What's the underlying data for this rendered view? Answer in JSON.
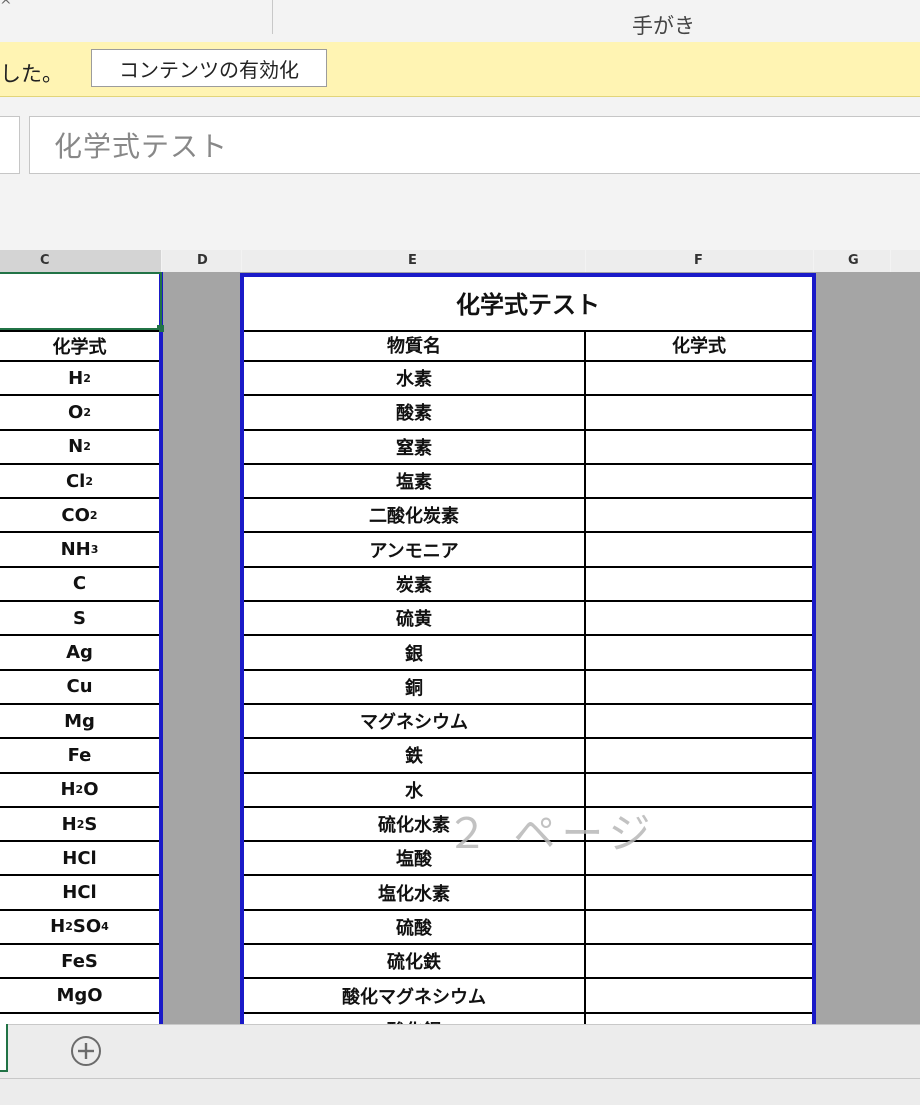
{
  "ribbon": {
    "group_label": "手がき",
    "caret": "^"
  },
  "message_bar": {
    "text": "した。",
    "enable_button": "コンテンツの有効化"
  },
  "formula_bar": {
    "value": "化学式テスト"
  },
  "columns": [
    "C",
    "D",
    "E",
    "F",
    "G"
  ],
  "left_table": {
    "header": "化学式",
    "formulas": [
      {
        "base": "H",
        "sub": "2",
        "tail": ""
      },
      {
        "base": "O",
        "sub": "2",
        "tail": ""
      },
      {
        "base": "N",
        "sub": "2",
        "tail": ""
      },
      {
        "base": "Cl",
        "sub": "2",
        "tail": ""
      },
      {
        "base": "CO",
        "sub": "2",
        "tail": ""
      },
      {
        "base": "NH",
        "sub": "3",
        "tail": ""
      },
      {
        "base": "C",
        "sub": "",
        "tail": ""
      },
      {
        "base": "S",
        "sub": "",
        "tail": ""
      },
      {
        "base": "Ag",
        "sub": "",
        "tail": ""
      },
      {
        "base": "Cu",
        "sub": "",
        "tail": ""
      },
      {
        "base": "Mg",
        "sub": "",
        "tail": ""
      },
      {
        "base": "Fe",
        "sub": "",
        "tail": ""
      },
      {
        "base": "H",
        "sub": "2",
        "tail": "O"
      },
      {
        "base": "H",
        "sub": "2",
        "tail": "S"
      },
      {
        "base": "HCl",
        "sub": "",
        "tail": ""
      },
      {
        "base": "HCl",
        "sub": "",
        "tail": ""
      },
      {
        "base": "H",
        "sub": "2",
        "tail": "SO",
        "sub2": "4"
      },
      {
        "base": "FeS",
        "sub": "",
        "tail": ""
      },
      {
        "base": "MgO",
        "sub": "",
        "tail": ""
      }
    ]
  },
  "test_table": {
    "title": "化学式テスト",
    "header_name": "物質名",
    "header_formula": "化学式",
    "substances": [
      "水素",
      "酸素",
      "窒素",
      "塩素",
      "二酸化炭素",
      "アンモニア",
      "炭素",
      "硫黄",
      "銀",
      "銅",
      "マグネシウム",
      "鉄",
      "水",
      "硫化水素",
      "塩酸",
      "塩化水素",
      "硫酸",
      "硫化鉄",
      "酸化マグネシウム",
      "酸化銅"
    ]
  },
  "watermark": "２ ページ",
  "sheet_tabs": {
    "add_icon": "plus-circle-icon"
  },
  "colors": {
    "page_border": "#1a1ac8",
    "selection": "#217346",
    "message_bar": "#fff4b3"
  }
}
